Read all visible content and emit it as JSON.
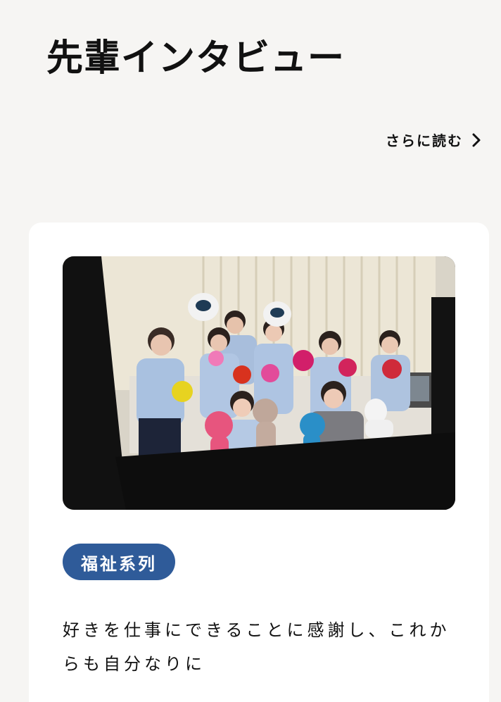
{
  "section": {
    "title": "先輩インタビュー",
    "read_more_label": "さらに読む",
    "read_more_icon": "chevron-right-icon"
  },
  "card": {
    "image": {
      "subject": "students-with-hand-puppets-photo"
    },
    "category": {
      "label": "福祉系列",
      "color": "#2f5b99"
    },
    "headline": "好きを仕事にできることに感謝し、これからも自分なりに"
  },
  "colors": {
    "page_background": "#f6f5f3",
    "card_background": "#ffffff",
    "badge_background": "#2f5b99",
    "text": "#111111"
  }
}
